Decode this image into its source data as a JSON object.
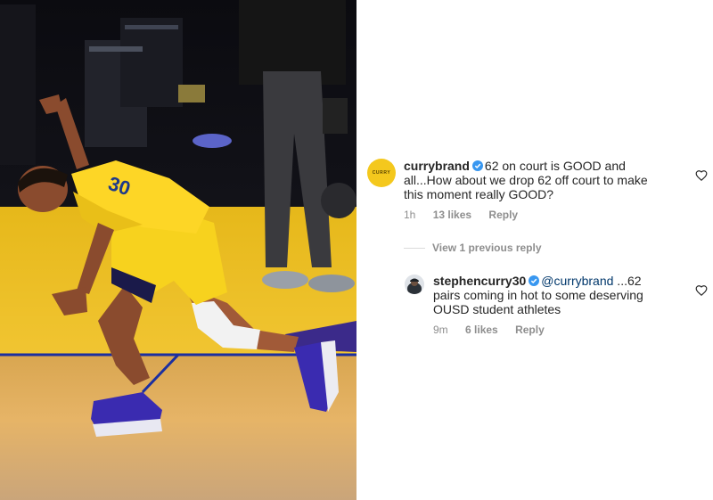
{
  "post_image": {
    "jersey_number": "30"
  },
  "comments": [
    {
      "avatar_text": "CURRY",
      "username": "currybrand",
      "verified": true,
      "text_line1": "62 on court is GOOD and",
      "text_line2": "all...How about we drop 62 off court to make",
      "text_line3": "this moment really GOOD?",
      "time": "1h",
      "likes": "13 likes",
      "reply_label": "Reply",
      "view_replies_label": "View 1 previous reply"
    },
    {
      "username": "stephencurry30",
      "verified": true,
      "mention": "@currybrand",
      "text_line1_rest": " ...62",
      "text_line2": "pairs coming in hot to some deserving",
      "text_line3": "OUSD student athletes",
      "time": "9m",
      "likes": "6 likes",
      "reply_label": "Reply"
    }
  ],
  "colors": {
    "accent_verified": "#3897f0",
    "brand_yellow": "#f4c81d",
    "jersey_gold": "#fdd626",
    "shoe_blue": "#3a2bb0",
    "court_blue": "#1b2fa0"
  },
  "icons": [
    "verified-badge-icon",
    "heart-icon"
  ]
}
